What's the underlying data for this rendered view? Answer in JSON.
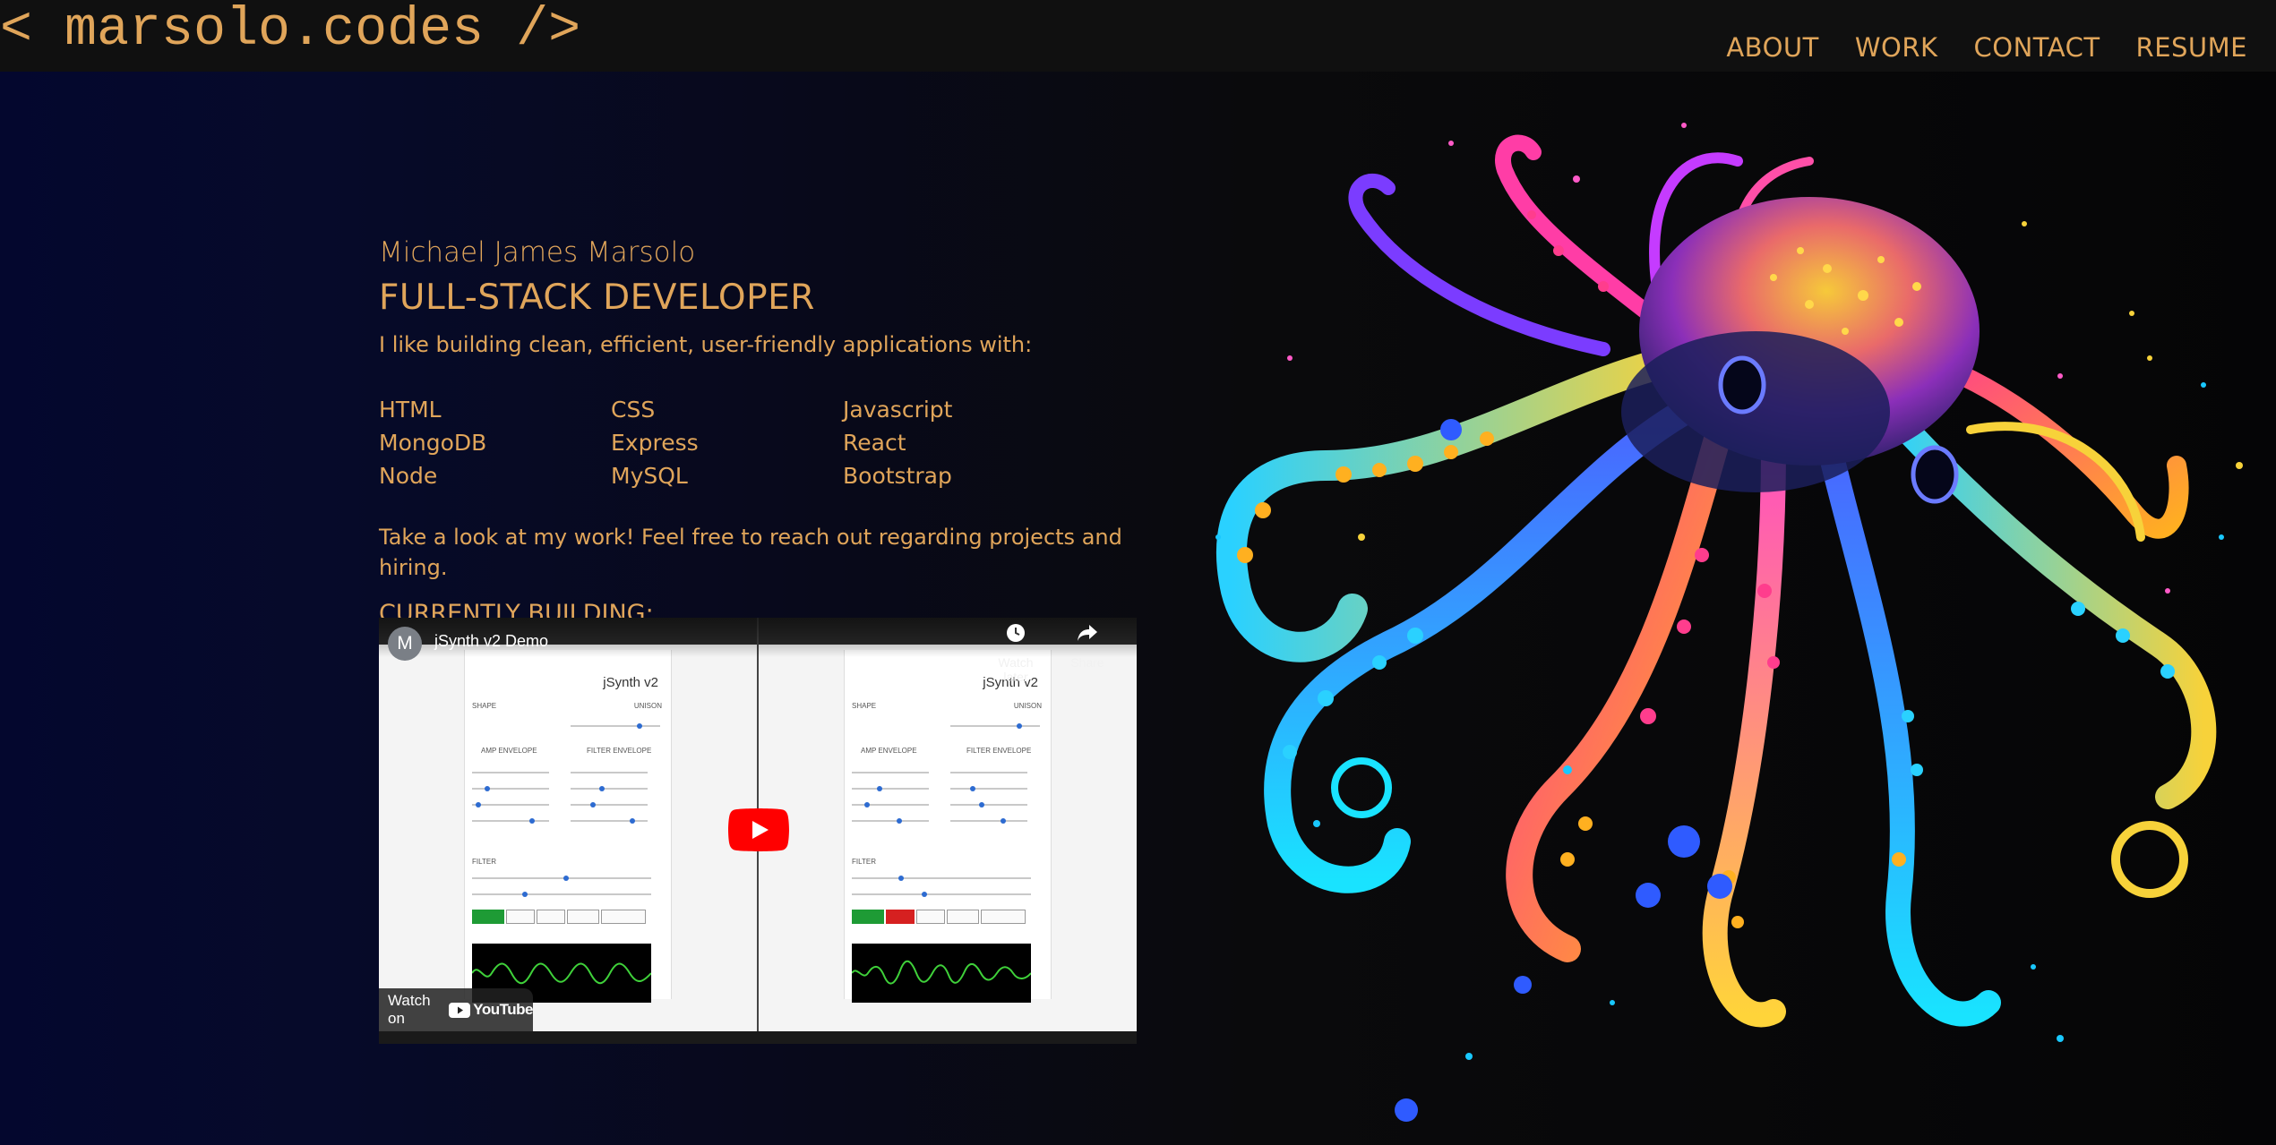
{
  "header": {
    "logo": "< marsolo.codes />",
    "nav": [
      "ABOUT",
      "WORK",
      "CONTACT",
      "RESUME"
    ]
  },
  "intro": {
    "name": "Michael James Marsolo",
    "role": "FULL-STACK DEVELOPER",
    "tagline": "I like building clean, efficient, user-friendly applications with:",
    "skills": [
      "HTML",
      "CSS",
      "Javascript",
      "MongoDB",
      "Express",
      "React",
      "Node",
      "MySQL",
      "Bootstrap"
    ],
    "invite": "Take a look at my work! Feel free to reach out regarding projects and hiring.",
    "building_label": "CURRENTLY BUILDING:"
  },
  "video": {
    "channel_initial": "M",
    "title": "jSynth v2 Demo",
    "watch_later": "Watch later",
    "share": "Share",
    "watch_on": "Watch on",
    "youtube": "YouTube",
    "app_title": "jSynth v2"
  },
  "colors": {
    "accent": "#e0a55a",
    "background": "#0b0b0c",
    "gradient_left": "#04072e",
    "youtube_red": "#ff0000"
  },
  "icons": {
    "watch_later": "clock-icon",
    "share": "share-arrow-icon",
    "play": "youtube-play-icon",
    "art": "neon-octopus-illustration"
  }
}
